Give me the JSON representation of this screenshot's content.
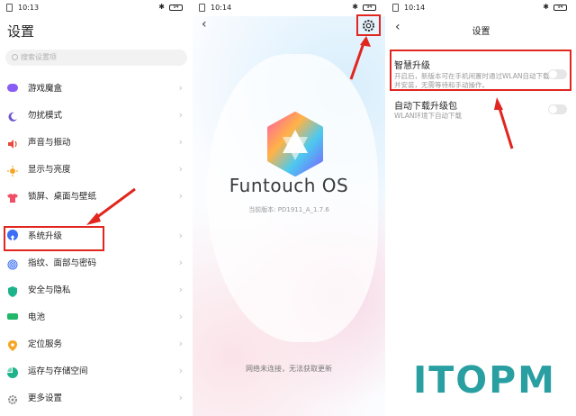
{
  "status_bars": [
    {
      "time": "10:13",
      "battery": "94"
    },
    {
      "time": "10:14",
      "battery": "94"
    },
    {
      "time": "10:14",
      "battery": "94"
    }
  ],
  "settings": {
    "title": "设置",
    "search_placeholder": "搜索设置项",
    "items": [
      {
        "label": "游戏魔盒",
        "icon": "gamepad-icon",
        "color": "#8a5cf6"
      },
      {
        "label": "勿扰模式",
        "icon": "moon-icon",
        "color": "#6e56cf"
      },
      {
        "label": "声音与振动",
        "icon": "speaker-icon",
        "color": "#e84a3a"
      },
      {
        "label": "显示与亮度",
        "icon": "sun-icon",
        "color": "#f6a623"
      },
      {
        "label": "锁屏、桌面与壁纸",
        "icon": "shirt-icon",
        "color": "#f04e64"
      },
      {
        "label": "系统升级",
        "icon": "upgrade-icon",
        "color": "#3b6ef6"
      },
      {
        "label": "指纹、面部与密码",
        "icon": "fingerprint-icon",
        "color": "#3b6ef6"
      },
      {
        "label": "安全与隐私",
        "icon": "shield-icon",
        "color": "#1db38b"
      },
      {
        "label": "电池",
        "icon": "battery-icon",
        "color": "#22b86a"
      },
      {
        "label": "定位服务",
        "icon": "location-icon",
        "color": "#f6a623"
      },
      {
        "label": "运存与存储空间",
        "icon": "pie-icon",
        "color": "#1db38b"
      },
      {
        "label": "更多设置",
        "icon": "gear-icon",
        "color": "#8a8a8a"
      }
    ]
  },
  "upgrade": {
    "brand": "Funtouch OS",
    "version": "当前版本: PD1911_A_1.7.6",
    "network_message": "网络未连接，无法获取更新"
  },
  "upgrade_settings": {
    "title": "设置",
    "options": [
      {
        "title": "智慧升级",
        "desc": "开启后，新版本可在手机闲置时通过WLAN自动下载并安装，无需等待和手动操作。",
        "enabled": false
      },
      {
        "title": "自动下载升级包",
        "desc": "WLAN环境下自动下载",
        "enabled": false
      }
    ]
  },
  "watermark": "ITOPM",
  "colors": {
    "highlight": "#e0261e",
    "watermark": "#2a9fa2"
  }
}
